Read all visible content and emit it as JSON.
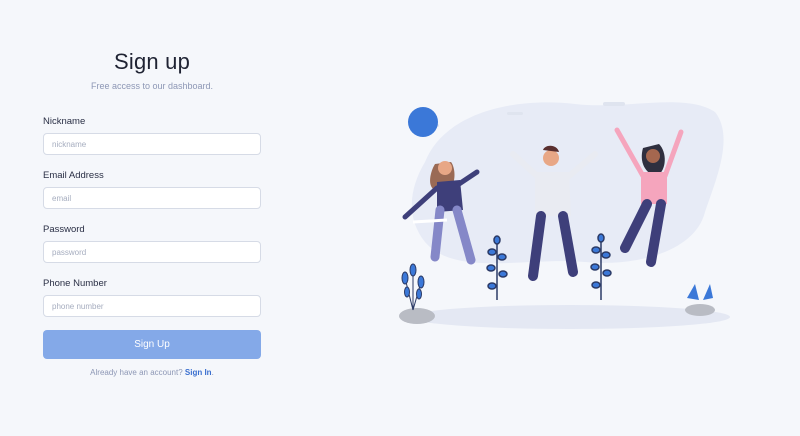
{
  "header": {
    "title": "Sign up",
    "subtitle": "Free access to our dashboard."
  },
  "fields": {
    "nickname": {
      "label": "Nickname",
      "placeholder": "nickname"
    },
    "email": {
      "label": "Email Address",
      "placeholder": "email"
    },
    "password": {
      "label": "Password",
      "placeholder": "password"
    },
    "phone": {
      "label": "Phone Number",
      "placeholder": "phone number"
    }
  },
  "submit_label": "Sign Up",
  "footer": {
    "prompt": "Already have an account? ",
    "link": "Sign In",
    "suffix": "."
  },
  "colors": {
    "primary_button": "#84a9e8",
    "link": "#3a6fcf",
    "background": "#f5f7fb"
  }
}
